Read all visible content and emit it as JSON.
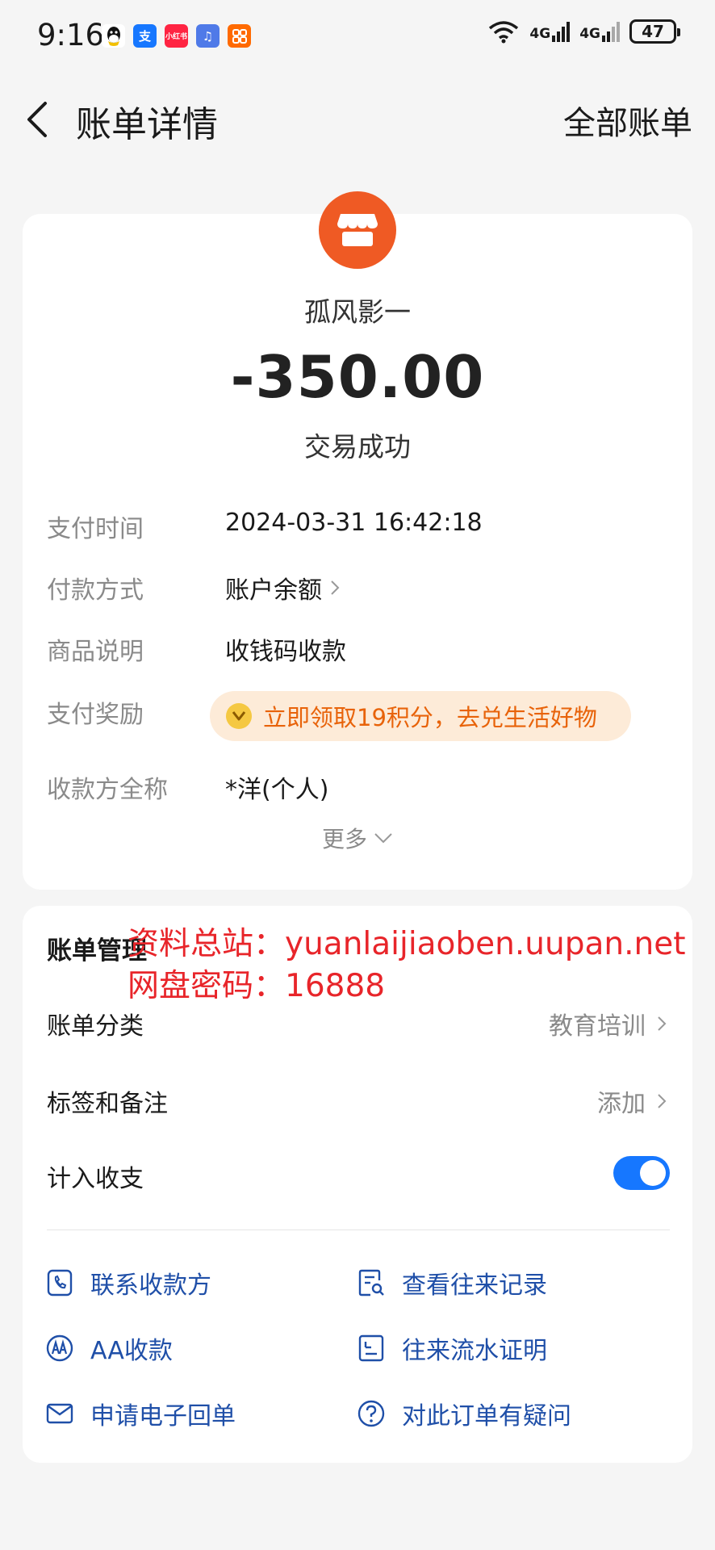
{
  "status_bar": {
    "time": "9:16",
    "app_icons": [
      "qq-icon",
      "alipay-icon",
      "xiaohongshu-icon",
      "music-icon",
      "taobao-icon"
    ],
    "network_1": "4G",
    "network_2": "4G",
    "battery": "47"
  },
  "header": {
    "title": "账单详情",
    "right_link": "全部账单"
  },
  "summary": {
    "merchant": "孤风影一",
    "amount": "-350.00",
    "status": "交易成功"
  },
  "details": {
    "pay_time_label": "支付时间",
    "pay_time_value": "2024-03-31 16:42:18",
    "pay_method_label": "付款方式",
    "pay_method_value": "账户余额",
    "goods_label": "商品说明",
    "goods_value": "收钱码收款",
    "reward_label": "支付奖励",
    "reward_value": "立即领取19积分，去兑生活好物",
    "payee_label": "收款方全称",
    "payee_value": "*洋(个人)",
    "more": "更多"
  },
  "management": {
    "title": "账单管理",
    "watermark_line1": "资料总站：yuanlaijiaoben.uupan.net",
    "watermark_line2": "网盘密码：16888",
    "category_label": "账单分类",
    "category_value": "教育培训",
    "tags_label": "标签和备注",
    "tags_value": "添加",
    "include_label": "计入收支",
    "include_on": true
  },
  "actions": {
    "contact": "联系收款方",
    "history": "查看往来记录",
    "aa": "AA收款",
    "proof": "往来流水证明",
    "receipt": "申请电子回单",
    "question": "对此订单有疑问"
  },
  "colors": {
    "accent": "#1677ff",
    "action_text": "#1f4fa8",
    "logo": "#ef5a24",
    "reward_text": "#e8630a",
    "watermark": "#e8252a"
  }
}
